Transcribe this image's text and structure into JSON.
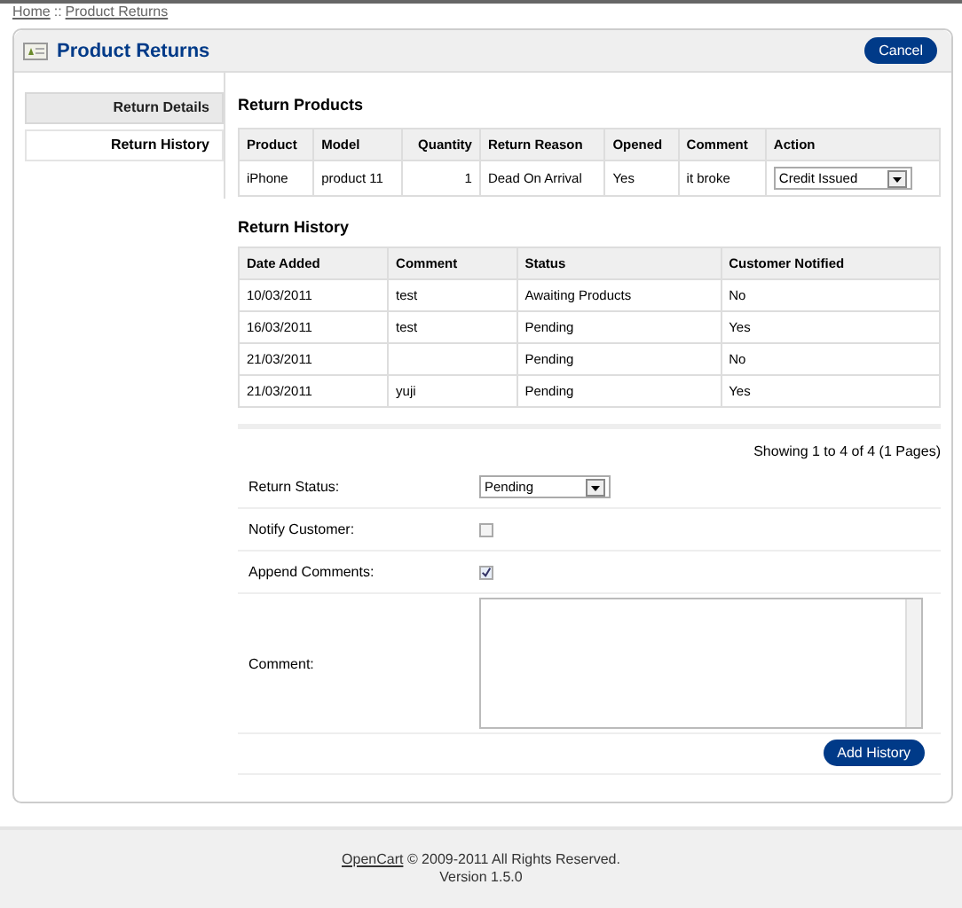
{
  "breadcrumb": {
    "items": [
      "Home",
      "Product Returns"
    ],
    "separator": "::"
  },
  "heading": {
    "title": "Product Returns",
    "cancel": "Cancel"
  },
  "tabs": [
    {
      "label": "Return Details",
      "selected": false
    },
    {
      "label": "Return History",
      "selected": true
    }
  ],
  "return_products": {
    "title": "Return Products",
    "columns": [
      "Product",
      "Model",
      "Quantity",
      "Return Reason",
      "Opened",
      "Comment",
      "Action"
    ],
    "rows": [
      {
        "cells": [
          "iPhone",
          "product 11",
          "1",
          "Dead On Arrival",
          "Yes",
          "it broke"
        ],
        "action": "Credit Issued"
      }
    ]
  },
  "return_history": {
    "title": "Return History",
    "columns": [
      "Date Added",
      "Comment",
      "Status",
      "Customer Notified"
    ],
    "rows": [
      [
        "10/03/2011",
        "test",
        "Awaiting Products",
        "No"
      ],
      [
        "16/03/2011",
        "test",
        "Pending",
        "Yes"
      ],
      [
        "21/03/2011",
        "",
        "Pending",
        "No"
      ],
      [
        "21/03/2011",
        "yuji",
        "Pending",
        "Yes"
      ]
    ],
    "pagination": "Showing 1 to 4 of 4 (1 Pages)"
  },
  "form": [
    {
      "kind": "select",
      "label": "Return Status:",
      "value": "Pending"
    },
    {
      "kind": "checkbox",
      "label": "Notify Customer:",
      "checked": false
    },
    {
      "kind": "checkbox",
      "label": "Append Comments:",
      "checked": true
    },
    {
      "kind": "textarea",
      "label": "Comment:"
    }
  ],
  "add_button": "Add History",
  "footer": {
    "link": "OpenCart",
    "text": "© 2009-2011 All Rights Reserved.",
    "version": "Version 1.5.0"
  }
}
